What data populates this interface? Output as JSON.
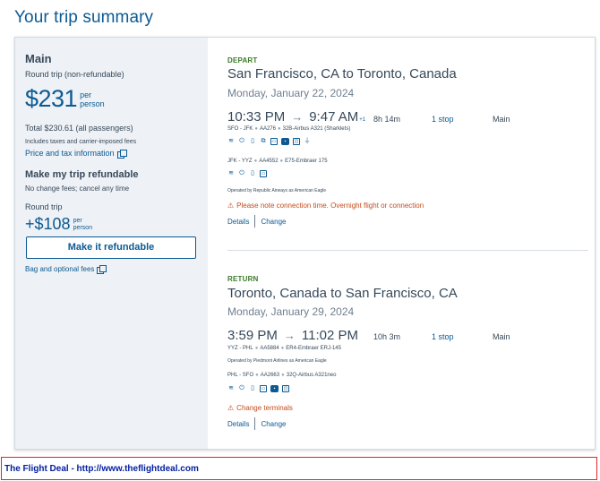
{
  "page_title": "Your trip summary",
  "sidebar": {
    "fare_name": "Main",
    "fare_type": "Round trip (non-refundable)",
    "price": "$231",
    "price_per": [
      "per",
      "person"
    ],
    "total": "Total $230.61 (all passengers)",
    "includes": "Includes taxes and carrier-imposed fees",
    "price_tax_link": "Price and tax information",
    "refund_title": "Make my trip refundable",
    "refund_sub": "No change fees; cancel any time",
    "round_trip_label": "Round trip",
    "refund_price": "+$108",
    "refund_per": [
      "per",
      "person"
    ],
    "refund_button": "Make it refundable",
    "bag_link": "Bag and optional fees"
  },
  "depart": {
    "label": "DEPART",
    "route": "San Francisco, CA to Toronto, Canada",
    "date": "Monday, January 22, 2024",
    "dep_time": "10:33 PM",
    "arr_time": "9:47 AM",
    "day_offset": "+1",
    "duration": "8h 14m",
    "stops": "1 stop",
    "cabin": "Main",
    "legs": [
      {
        "route": "SFO - JFK",
        "flight": "AA276",
        "aircraft": "32B-Airbus A321 (Sharklets)"
      },
      {
        "route": "JFK - YYZ",
        "flight": "AA4552",
        "aircraft": "E75-Embraer 175"
      }
    ],
    "operated_by": "Operated by Republic Airways as American Eagle",
    "warning": "Please note connection time. Overnight flight or connection",
    "details": "Details",
    "change": "Change"
  },
  "return": {
    "label": "RETURN",
    "route": "Toronto, Canada to San Francisco, CA",
    "date": "Monday, January 29, 2024",
    "dep_time": "3:59 PM",
    "arr_time": "11:02 PM",
    "duration": "10h 3m",
    "stops": "1 stop",
    "cabin": "Main",
    "legs": [
      {
        "route": "YYZ - PHL",
        "flight": "AA5884",
        "aircraft": "ER4-Embraer ERJ-145"
      },
      {
        "route": "PHL - SFO",
        "flight": "AA2663",
        "aircraft": "32Q-Airbus A321neo"
      }
    ],
    "operated_by": "Operated by Piedmont Airlines as American Eagle",
    "warning": "Change terminals",
    "details": "Details",
    "change": "Change"
  },
  "footer": "The Flight Deal - http://www.theflightdeal.com",
  "colors": {
    "link_blue": "#0b5a93",
    "text": "#36495a",
    "green": "#3e7a2a",
    "warning": "#c54b1c",
    "footer_border": "#e0262a",
    "footer_text": "#001ea0"
  }
}
